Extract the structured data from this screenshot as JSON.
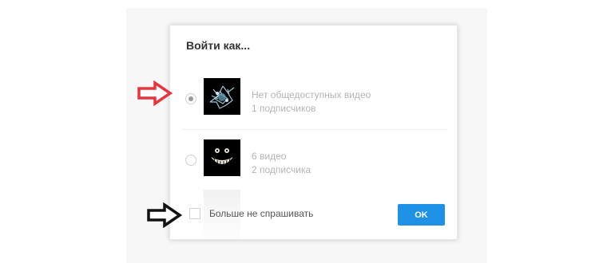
{
  "dialog": {
    "title": "Войти как...",
    "accounts": [
      {
        "selected": true,
        "avatar_icon": "spiky-blue-creature-avatar",
        "line1": "Нет общедоступных видео",
        "line2": "1   подписчиков"
      },
      {
        "selected": false,
        "avatar_icon": "grinning-mouth-avatar",
        "line1": "6 видео",
        "line2": "2 подписчика"
      }
    ],
    "dont_ask_label": "Больше не спрашивать",
    "dont_ask_checked": false,
    "ok_label": "OK"
  },
  "annotations": [
    {
      "icon": "arrow-right-icon",
      "color": "#e8343f"
    },
    {
      "icon": "arrow-right-icon",
      "color": "#111111"
    }
  ],
  "colors": {
    "accent": "#1e90e6",
    "muted_text": "#b3b3b3"
  }
}
